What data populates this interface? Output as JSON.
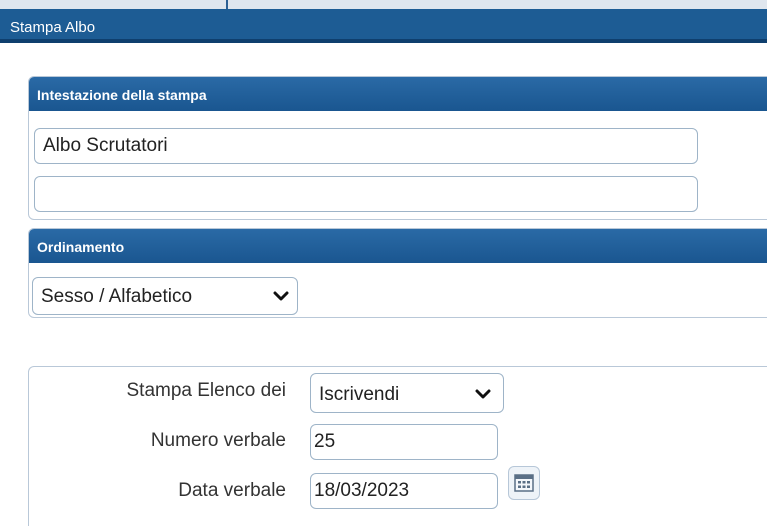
{
  "window": {
    "title": "Stampa Albo"
  },
  "intestazione": {
    "header": "Intestazione della stampa",
    "line1": "Albo Scrutatori",
    "line2": ""
  },
  "ordinamento": {
    "header": "Ordinamento",
    "selected": "Sesso / Alfabetico"
  },
  "form": {
    "elenco_label": "Stampa Elenco dei",
    "elenco_value": "Iscrivendi",
    "numero_label": "Numero verbale",
    "numero_value": "25",
    "data_label": "Data verbale",
    "data_value": "18/03/2023"
  },
  "icons": {
    "select_arrow": "chevron-down-icon",
    "date_picker": "calendar-icon"
  },
  "colors": {
    "titlebar": "#1d5c94",
    "panel_header": "#2a6aa6",
    "input_border": "#9eb4c8"
  }
}
